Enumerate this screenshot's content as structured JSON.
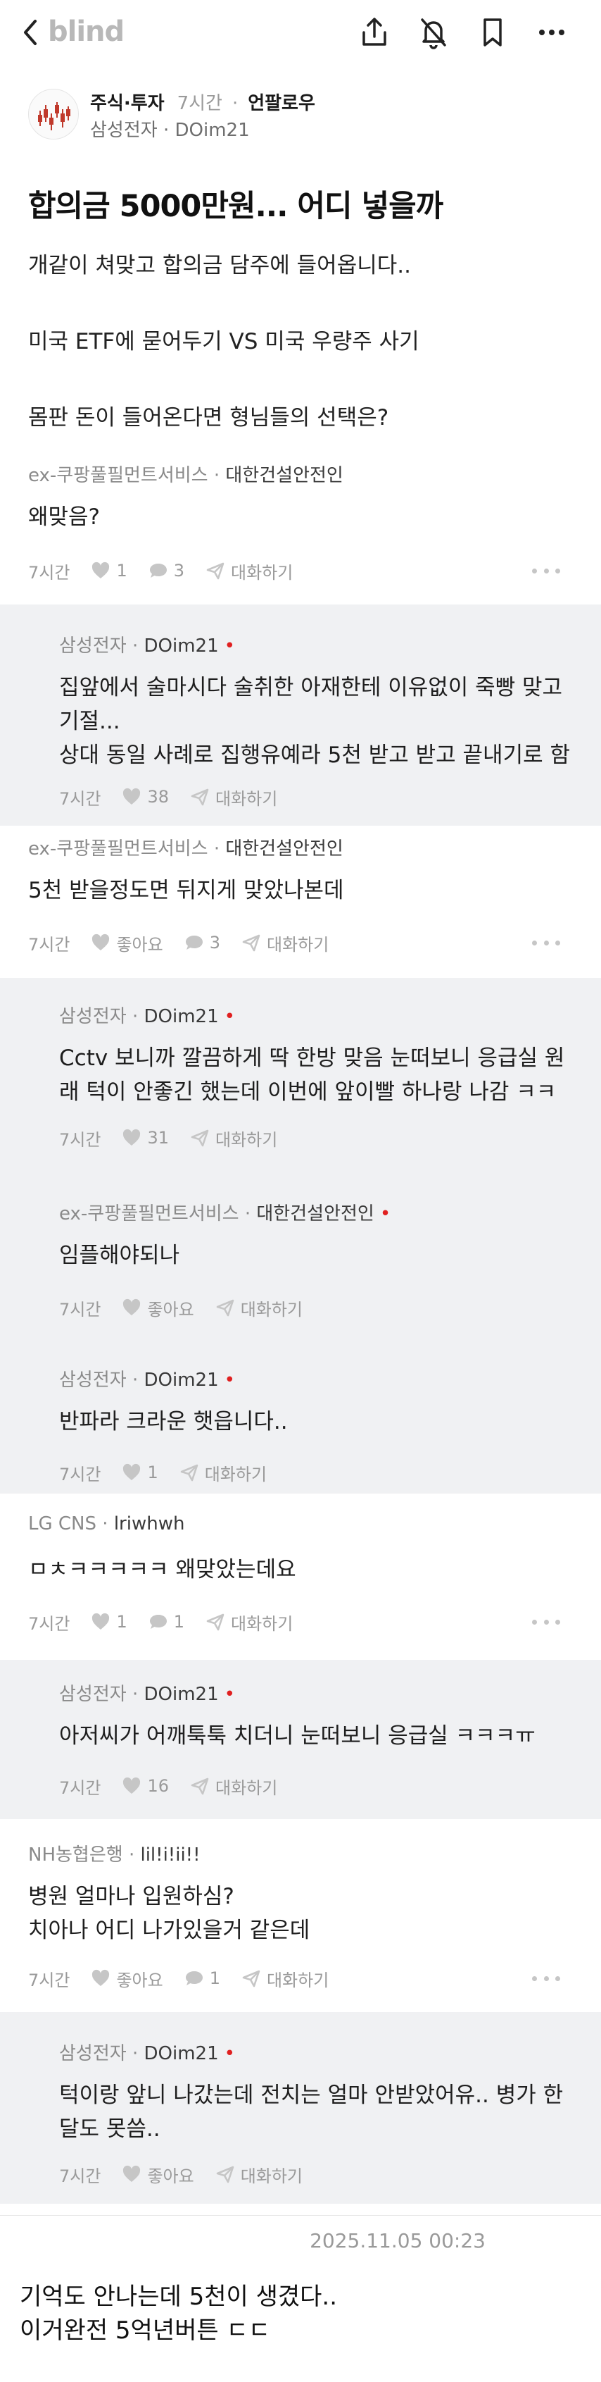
{
  "app": {
    "logo": "blind"
  },
  "post": {
    "board": "주식·투자",
    "time": "7시간",
    "follow": "언팔로우",
    "company": "삼성전자",
    "nickname": "DOim21",
    "title": "합의금 5000만원... 어디 넣을까",
    "body": "개같이 쳐맞고 합의금 담주에 들어옵니다..\n\n미국 ETF에 묻어두기 VS 미국 우량주 사기\n\n몸판 돈이 들어온다면 형님들의 선택은?"
  },
  "comments": [
    {
      "company": "ex-쿠팡풀필먼트서비스",
      "nickname": "대한건설안전인",
      "text": "왜맞음?",
      "time": "7시간",
      "likes": "1",
      "replies": "3",
      "chat": "대화하기"
    },
    {
      "company": "삼성전자",
      "nickname": "DOim21",
      "text": "집앞에서 술마시다 술취한 아재한테 이유없이 죽빵 맞고 기절...\n상대 동일 사례로 집행유예라 5천 받고 받고 끝내기로 함",
      "time": "7시간",
      "likes": "38",
      "chat": "대화하기"
    },
    {
      "company": "ex-쿠팡풀필먼트서비스",
      "nickname": "대한건설안전인",
      "text": "5천 받을정도면 뒤지게 맞았나본데",
      "time": "7시간",
      "likes": "좋아요",
      "replies": "3",
      "chat": "대화하기"
    },
    {
      "company": "삼성전자",
      "nickname": "DOim21",
      "text": "Cctv 보니까 깔끔하게 딱 한방 맞음 눈떠보니 응급실 원래 턱이 안좋긴 했는데 이번에 앞이빨 하나랑 나감 ㅋㅋ",
      "time": "7시간",
      "likes": "31",
      "chat": "대화하기"
    },
    {
      "company": "ex-쿠팡풀필먼트서비스",
      "nickname": "대한건설안전인",
      "text": "임플해야되나",
      "time": "7시간",
      "likes": "좋아요",
      "chat": "대화하기"
    },
    {
      "company": "삼성전자",
      "nickname": "DOim21",
      "text": "반파라 크라운 햇읍니다..",
      "time": "7시간",
      "likes": "1",
      "chat": "대화하기"
    },
    {
      "company": "LG CNS",
      "nickname": "lriwhwh",
      "text": "ㅁㅊㅋㅋㅋㅋㅋ 왜맞았는데요",
      "time": "7시간",
      "likes": "1",
      "replies": "1",
      "chat": "대화하기"
    },
    {
      "company": "삼성전자",
      "nickname": "DOim21",
      "text": "아저씨가 어깨툭툭 치더니 눈떠보니 응급실 ㅋㅋㅋㅠ",
      "time": "7시간",
      "likes": "16",
      "chat": "대화하기"
    },
    {
      "company": "NH농협은행",
      "nickname": "lil!i!ii!!",
      "text": "병원 얼마나 입원하심?\n치아나 어디 나가있을거 같은데",
      "time": "7시간",
      "likes": "좋아요",
      "replies": "1",
      "chat": "대화하기"
    },
    {
      "company": "삼성전자",
      "nickname": "DOim21",
      "text": "턱이랑 앞니 나갔는데 전치는 얼마 안받았어유.. 병가 한달도 못씀..",
      "time": "7시간",
      "likes": "좋아요",
      "chat": "대화하기"
    }
  ],
  "timestamp": "2025.11.05 00:23",
  "caption": "기억도 안나는데 5천이 생겼다..\n이거완전 5억년버튼 ㄷㄷ",
  "colors": {
    "reply_bg": "#f0f1f3",
    "author_dot": "#e02020",
    "muted": "#9a9a9a"
  },
  "icons": [
    "back-arrow-icon",
    "share-icon",
    "notification-off-icon",
    "bookmark-icon",
    "more-icon",
    "heart-icon",
    "comment-icon",
    "send-icon"
  ]
}
